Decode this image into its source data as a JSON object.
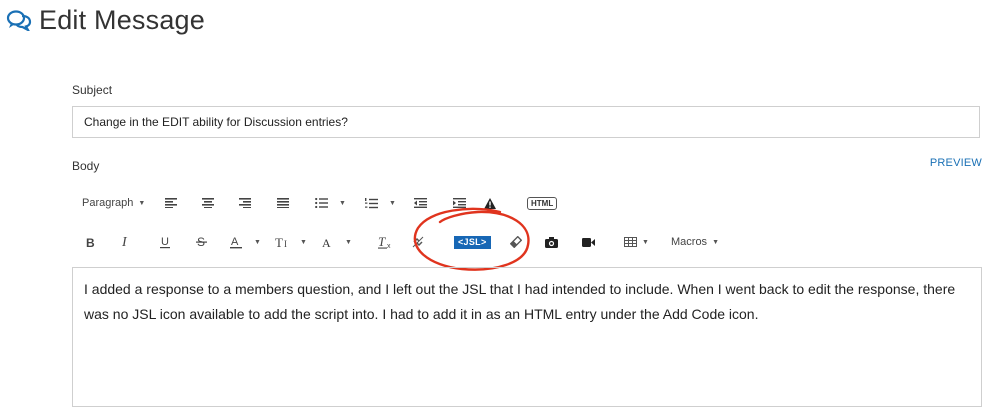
{
  "page": {
    "title": "Edit Message",
    "icon": "chat-bubbles-icon",
    "accent_color": "#1a70b5"
  },
  "form": {
    "subject_label": "Subject",
    "subject_value": "Change in the EDIT ability for Discussion entries?",
    "body_label": "Body",
    "preview_label": "PREVIEW"
  },
  "toolbar": {
    "paragraph_label": "Paragraph",
    "html_label": "HTML",
    "jsl_label": "<JSL>",
    "macros_label": "Macros",
    "jsl_color": "#1767b5",
    "row1_icons": [
      "paragraph-select",
      "align-left-icon",
      "align-center-icon",
      "align-right-icon",
      "align-justify-icon",
      "bullet-list-icon",
      "numbered-list-icon",
      "outdent-icon",
      "indent-icon",
      "warning-icon",
      "html-icon"
    ],
    "row2_icons": [
      "bold-icon",
      "italic-icon",
      "underline-icon",
      "strikethrough-icon",
      "text-color-icon",
      "font-size-icon",
      "font-family-icon",
      "clear-format-icon",
      "unlink-icon",
      "jsl-icon",
      "eraser-icon",
      "camera-icon",
      "video-icon",
      "table-icon",
      "macros-dropdown"
    ]
  },
  "editor": {
    "body_text": "I added a response to a members question, and I left out the JSL that I had intended to include.  When I went back to edit the response, there was no  JSL icon available to add the script into.  I had to add it in as an HTML entry under the Add Code icon."
  },
  "annotation": {
    "circle_color": "#e0341e"
  }
}
